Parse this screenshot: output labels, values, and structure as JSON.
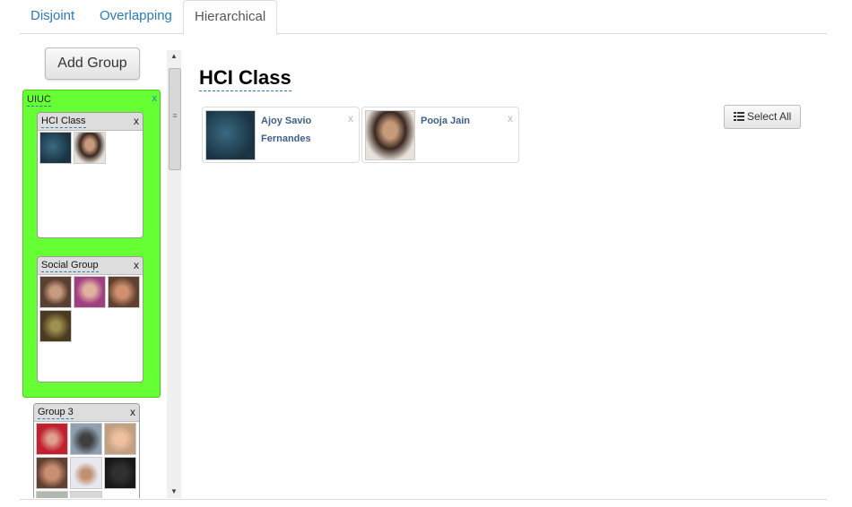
{
  "tabs": [
    {
      "label": "Disjoint",
      "active": false
    },
    {
      "label": "Overlapping",
      "active": false
    },
    {
      "label": "Hierarchical",
      "active": true
    }
  ],
  "sidebar": {
    "add_group_label": "Add Group",
    "parent_group": {
      "title": "UIUC",
      "close": "x",
      "color": "#66ff33",
      "groups": [
        {
          "title": "HCI Class",
          "close": "x"
        },
        {
          "title": "Social Group",
          "close": "x"
        }
      ]
    },
    "group3": {
      "title": "Group 3",
      "close": "x"
    }
  },
  "main": {
    "title": "HCI Class",
    "select_all_label": "Select All",
    "members": [
      {
        "name": "Ajoy Savio Fernandes",
        "close": "x"
      },
      {
        "name": "Pooja Jain",
        "close": "x"
      }
    ]
  },
  "colors": {
    "link": "#2a7ab8",
    "member_name": "#3e5f8a"
  }
}
